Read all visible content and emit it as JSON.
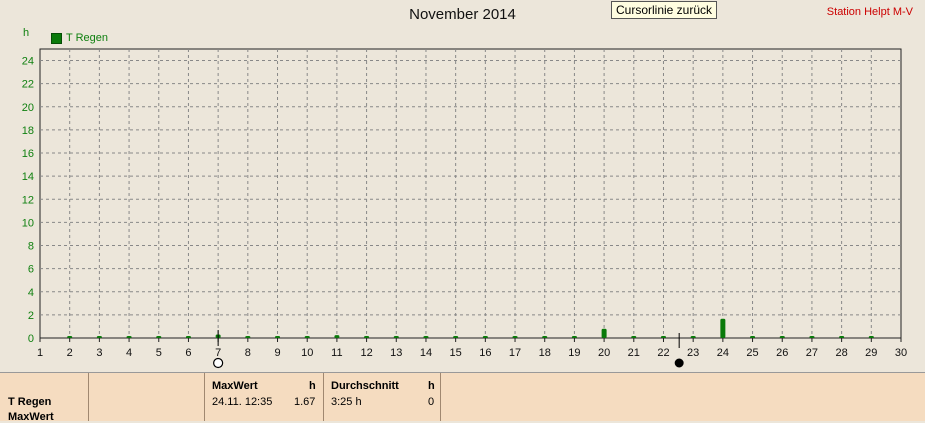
{
  "header": {
    "title": "November 2014",
    "tooltip": "Cursorlinie zurück",
    "station": "Station Helpt M-V"
  },
  "colors": {
    "series": "#0a7a0a",
    "axis_text": "#108010",
    "grid": "#888888",
    "station": "#cc0000",
    "panel_bg": "#f5dcc0"
  },
  "chart_data": {
    "type": "bar",
    "title": "November 2014",
    "ylabel": "h",
    "xlabel": "",
    "ylim": [
      0,
      25
    ],
    "yticks": [
      0,
      2,
      4,
      6,
      8,
      10,
      12,
      14,
      16,
      18,
      20,
      22,
      24
    ],
    "xlim": [
      1,
      30
    ],
    "xticks": [
      1,
      2,
      3,
      4,
      5,
      6,
      7,
      8,
      9,
      10,
      11,
      12,
      13,
      14,
      15,
      16,
      17,
      18,
      19,
      20,
      21,
      22,
      23,
      24,
      25,
      26,
      27,
      28,
      29,
      30
    ],
    "legend": "top-left",
    "grid": true,
    "series": [
      {
        "name": "T Regen",
        "points": [
          {
            "x": 2,
            "y": 0.05
          },
          {
            "x": 3,
            "y": 0.03
          },
          {
            "x": 4,
            "y": 0.03
          },
          {
            "x": 5,
            "y": 0.03
          },
          {
            "x": 6,
            "y": 0.03
          },
          {
            "x": 7,
            "y": 0.3
          },
          {
            "x": 8,
            "y": 0.03
          },
          {
            "x": 9,
            "y": 0.1
          },
          {
            "x": 10,
            "y": 0.05
          },
          {
            "x": 11,
            "y": 0.25
          },
          {
            "x": 12,
            "y": 0.05
          },
          {
            "x": 13,
            "y": 0.03
          },
          {
            "x": 14,
            "y": 0.03
          },
          {
            "x": 15,
            "y": 0.03
          },
          {
            "x": 16,
            "y": 0.05
          },
          {
            "x": 17,
            "y": 0.03
          },
          {
            "x": 18,
            "y": 0.03
          },
          {
            "x": 19,
            "y": 0.15
          },
          {
            "x": 20,
            "y": 0.8
          },
          {
            "x": 21,
            "y": 0.03
          },
          {
            "x": 22,
            "y": 0.03
          },
          {
            "x": 23,
            "y": 0.05
          },
          {
            "x": 24,
            "y": 1.67
          },
          {
            "x": 25,
            "y": 0.05
          },
          {
            "x": 26,
            "y": 0.03
          },
          {
            "x": 27,
            "y": 0.03
          },
          {
            "x": 28,
            "y": 0.03
          },
          {
            "x": 29,
            "y": 0.03
          }
        ]
      }
    ]
  },
  "markers": {
    "open_circle_x": 7,
    "filled_circle_x": 23
  },
  "panel": {
    "series_label": "T Regen",
    "series_label2": "MaxWert",
    "max_header": "MaxWert",
    "max_unit": "h",
    "max_date": "24.11.  12:35",
    "max_value": "1.67",
    "avg_header": "Durchschnitt",
    "avg_unit": "h",
    "avg_value": "3:25 h",
    "avg_count": "0"
  }
}
